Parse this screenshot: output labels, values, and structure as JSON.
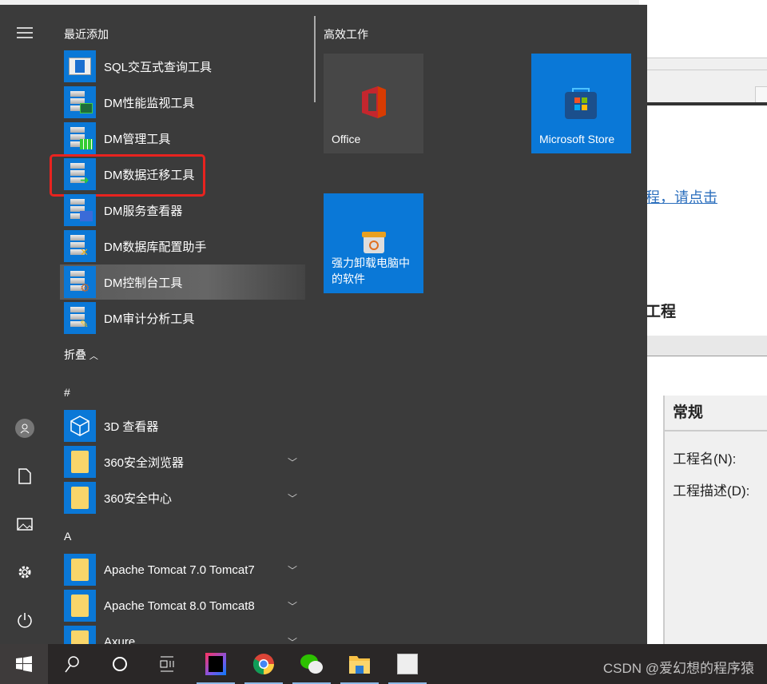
{
  "start_menu": {
    "recent_header": "最近添加",
    "recent": [
      {
        "label": "SQL交互式查询工具",
        "icon": "sql-query-icon"
      },
      {
        "label": "DM性能监视工具",
        "icon": "performance-monitor-icon"
      },
      {
        "label": "DM管理工具",
        "icon": "manager-icon"
      },
      {
        "label": "DM数据迁移工具",
        "icon": "data-migration-icon",
        "highlighted": true
      },
      {
        "label": "DM服务查看器",
        "icon": "service-viewer-icon"
      },
      {
        "label": "DM数据库配置助手",
        "icon": "db-config-icon"
      },
      {
        "label": "DM控制台工具",
        "icon": "console-icon",
        "hovered": true
      },
      {
        "label": "DM审计分析工具",
        "icon": "audit-icon"
      }
    ],
    "collapse_label": "折叠",
    "group_hash": "#",
    "hash_items": [
      {
        "label": "3D 查看器",
        "icon": "3d-viewer-icon"
      },
      {
        "label": "360安全浏览器",
        "icon": "folder-icon",
        "expandable": true
      },
      {
        "label": "360安全中心",
        "icon": "folder-icon",
        "expandable": true
      }
    ],
    "group_a": "A",
    "a_items": [
      {
        "label": "Apache Tomcat 7.0 Tomcat7",
        "icon": "folder-icon",
        "expandable": true
      },
      {
        "label": "Apache Tomcat 8.0 Tomcat8",
        "icon": "folder-icon",
        "expandable": true
      },
      {
        "label": "Axure",
        "icon": "folder-icon",
        "expandable": true
      }
    ],
    "tiles_header": "高效工作",
    "tiles": [
      {
        "label": "Office"
      },
      {
        "label": "Microsoft Store"
      },
      {
        "label": "强力卸载电脑中的软件"
      }
    ],
    "highlight_color": "#e8231f",
    "accent": "#0a78d7"
  },
  "background_window": {
    "link": "程，请点击",
    "heading": "工程",
    "section": "常规",
    "field_name": "工程名(N):",
    "field_desc": "工程描述(D):"
  },
  "taskbar": {
    "icons": [
      "windows-start-icon",
      "search-icon",
      "cortana-icon",
      "task-view-icon",
      "intellij-icon",
      "chrome-icon",
      "wechat-icon",
      "file-explorer-icon",
      "typora-icon"
    ]
  },
  "watermark": "CSDN @爱幻想的程序猿"
}
